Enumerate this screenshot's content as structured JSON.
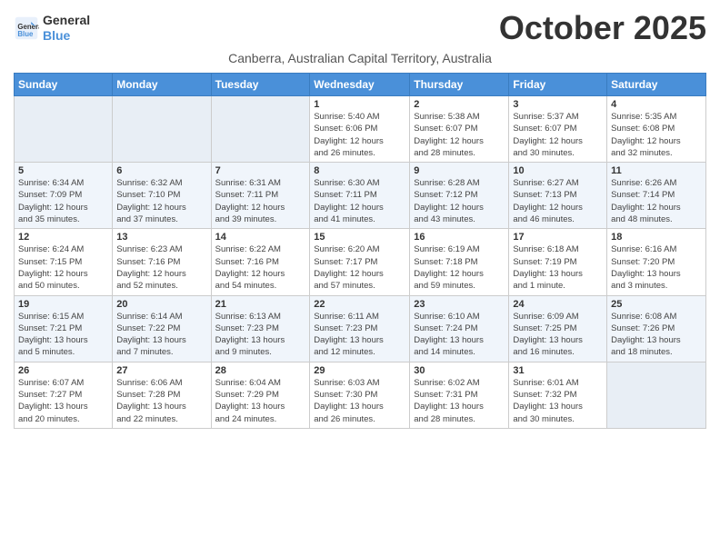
{
  "header": {
    "logo_line1": "General",
    "logo_line2": "Blue",
    "month": "October 2025",
    "subtitle": "Canberra, Australian Capital Territory, Australia"
  },
  "weekdays": [
    "Sunday",
    "Monday",
    "Tuesday",
    "Wednesday",
    "Thursday",
    "Friday",
    "Saturday"
  ],
  "weeks": [
    [
      {
        "day": "",
        "info": ""
      },
      {
        "day": "",
        "info": ""
      },
      {
        "day": "",
        "info": ""
      },
      {
        "day": "1",
        "info": "Sunrise: 5:40 AM\nSunset: 6:06 PM\nDaylight: 12 hours\nand 26 minutes."
      },
      {
        "day": "2",
        "info": "Sunrise: 5:38 AM\nSunset: 6:07 PM\nDaylight: 12 hours\nand 28 minutes."
      },
      {
        "day": "3",
        "info": "Sunrise: 5:37 AM\nSunset: 6:07 PM\nDaylight: 12 hours\nand 30 minutes."
      },
      {
        "day": "4",
        "info": "Sunrise: 5:35 AM\nSunset: 6:08 PM\nDaylight: 12 hours\nand 32 minutes."
      }
    ],
    [
      {
        "day": "5",
        "info": "Sunrise: 6:34 AM\nSunset: 7:09 PM\nDaylight: 12 hours\nand 35 minutes."
      },
      {
        "day": "6",
        "info": "Sunrise: 6:32 AM\nSunset: 7:10 PM\nDaylight: 12 hours\nand 37 minutes."
      },
      {
        "day": "7",
        "info": "Sunrise: 6:31 AM\nSunset: 7:11 PM\nDaylight: 12 hours\nand 39 minutes."
      },
      {
        "day": "8",
        "info": "Sunrise: 6:30 AM\nSunset: 7:11 PM\nDaylight: 12 hours\nand 41 minutes."
      },
      {
        "day": "9",
        "info": "Sunrise: 6:28 AM\nSunset: 7:12 PM\nDaylight: 12 hours\nand 43 minutes."
      },
      {
        "day": "10",
        "info": "Sunrise: 6:27 AM\nSunset: 7:13 PM\nDaylight: 12 hours\nand 46 minutes."
      },
      {
        "day": "11",
        "info": "Sunrise: 6:26 AM\nSunset: 7:14 PM\nDaylight: 12 hours\nand 48 minutes."
      }
    ],
    [
      {
        "day": "12",
        "info": "Sunrise: 6:24 AM\nSunset: 7:15 PM\nDaylight: 12 hours\nand 50 minutes."
      },
      {
        "day": "13",
        "info": "Sunrise: 6:23 AM\nSunset: 7:16 PM\nDaylight: 12 hours\nand 52 minutes."
      },
      {
        "day": "14",
        "info": "Sunrise: 6:22 AM\nSunset: 7:16 PM\nDaylight: 12 hours\nand 54 minutes."
      },
      {
        "day": "15",
        "info": "Sunrise: 6:20 AM\nSunset: 7:17 PM\nDaylight: 12 hours\nand 57 minutes."
      },
      {
        "day": "16",
        "info": "Sunrise: 6:19 AM\nSunset: 7:18 PM\nDaylight: 12 hours\nand 59 minutes."
      },
      {
        "day": "17",
        "info": "Sunrise: 6:18 AM\nSunset: 7:19 PM\nDaylight: 13 hours\nand 1 minute."
      },
      {
        "day": "18",
        "info": "Sunrise: 6:16 AM\nSunset: 7:20 PM\nDaylight: 13 hours\nand 3 minutes."
      }
    ],
    [
      {
        "day": "19",
        "info": "Sunrise: 6:15 AM\nSunset: 7:21 PM\nDaylight: 13 hours\nand 5 minutes."
      },
      {
        "day": "20",
        "info": "Sunrise: 6:14 AM\nSunset: 7:22 PM\nDaylight: 13 hours\nand 7 minutes."
      },
      {
        "day": "21",
        "info": "Sunrise: 6:13 AM\nSunset: 7:23 PM\nDaylight: 13 hours\nand 9 minutes."
      },
      {
        "day": "22",
        "info": "Sunrise: 6:11 AM\nSunset: 7:23 PM\nDaylight: 13 hours\nand 12 minutes."
      },
      {
        "day": "23",
        "info": "Sunrise: 6:10 AM\nSunset: 7:24 PM\nDaylight: 13 hours\nand 14 minutes."
      },
      {
        "day": "24",
        "info": "Sunrise: 6:09 AM\nSunset: 7:25 PM\nDaylight: 13 hours\nand 16 minutes."
      },
      {
        "day": "25",
        "info": "Sunrise: 6:08 AM\nSunset: 7:26 PM\nDaylight: 13 hours\nand 18 minutes."
      }
    ],
    [
      {
        "day": "26",
        "info": "Sunrise: 6:07 AM\nSunset: 7:27 PM\nDaylight: 13 hours\nand 20 minutes."
      },
      {
        "day": "27",
        "info": "Sunrise: 6:06 AM\nSunset: 7:28 PM\nDaylight: 13 hours\nand 22 minutes."
      },
      {
        "day": "28",
        "info": "Sunrise: 6:04 AM\nSunset: 7:29 PM\nDaylight: 13 hours\nand 24 minutes."
      },
      {
        "day": "29",
        "info": "Sunrise: 6:03 AM\nSunset: 7:30 PM\nDaylight: 13 hours\nand 26 minutes."
      },
      {
        "day": "30",
        "info": "Sunrise: 6:02 AM\nSunset: 7:31 PM\nDaylight: 13 hours\nand 28 minutes."
      },
      {
        "day": "31",
        "info": "Sunrise: 6:01 AM\nSunset: 7:32 PM\nDaylight: 13 hours\nand 30 minutes."
      },
      {
        "day": "",
        "info": ""
      }
    ]
  ]
}
